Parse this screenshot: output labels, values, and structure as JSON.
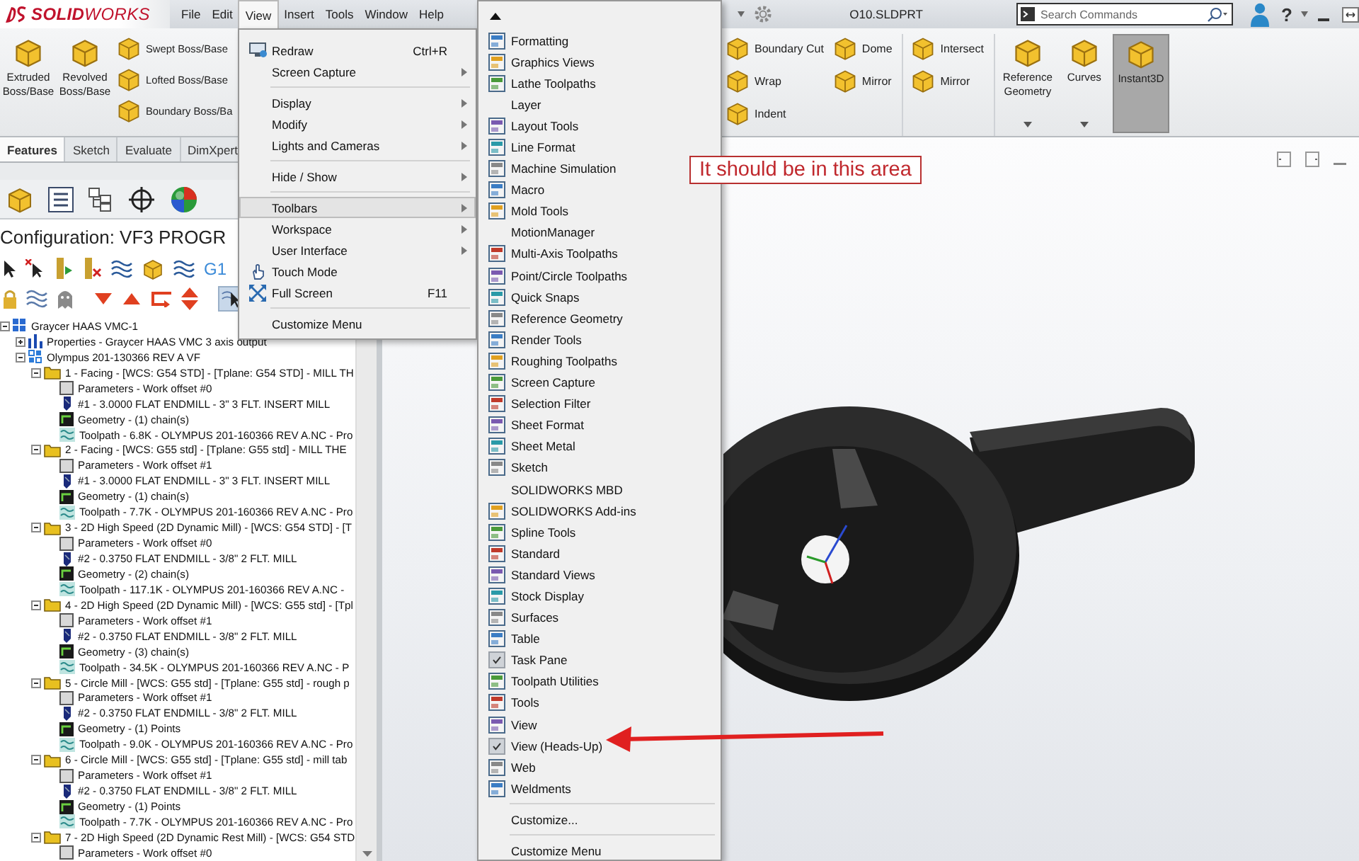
{
  "title_bar": {
    "logo": "**SOLID**WORKS",
    "menus": [
      {
        "label": "File",
        "selected": false
      },
      {
        "label": "Edit",
        "selected": false
      },
      {
        "label": "View",
        "selected": true
      },
      {
        "label": "Insert",
        "selected": false
      },
      {
        "label": "Tools",
        "selected": false
      },
      {
        "label": "Window",
        "selected": false
      },
      {
        "label": "Help",
        "selected": false
      }
    ],
    "document_title": "O10.SLDPRT",
    "search": {
      "placeholder": "Search Commands"
    },
    "help": "?"
  },
  "ribbon": {
    "left": [
      {
        "kind": "large",
        "label": "Extruded Boss/Base",
        "selected": false,
        "dropdown": false
      },
      {
        "kind": "large",
        "label": "Revolved Boss/Base",
        "selected": false,
        "dropdown": false
      },
      {
        "kind": "stack",
        "items": [
          "Swept Boss/Base",
          "Lofted Boss/Base",
          "Boundary Boss/Ba"
        ]
      }
    ],
    "right": [
      {
        "kind": "stack",
        "items": [
          "Boundary Cut",
          "Wrap",
          "Indent"
        ]
      },
      {
        "kind": "stack",
        "items": [
          "Dome",
          "Mirror"
        ]
      },
      {
        "kind": "stack",
        "items": [
          "Intersect",
          "Mirror"
        ]
      },
      {
        "kind": "large",
        "label": "Reference Geometry",
        "selected": false,
        "dropdown": true
      },
      {
        "kind": "large",
        "label": "Curves",
        "selected": false,
        "dropdown": true
      },
      {
        "kind": "large",
        "label": "Instant3D",
        "selected": true,
        "dropdown": false
      }
    ]
  },
  "feature_manager": {
    "tabs": [
      {
        "label": "Features",
        "selected": true
      },
      {
        "label": "Sketch",
        "selected": false
      },
      {
        "label": "Evaluate",
        "selected": false
      },
      {
        "label": "DimXpert",
        "selected": false
      }
    ],
    "configuration": "Configuration:  VF3 PROGR",
    "toolbar_label": "G1",
    "tree": [
      {
        "kind": "machine",
        "label": "Graycer HAAS VMC-1",
        "expanded": true,
        "children": [
          {
            "kind": "properties",
            "label": "Properties - Graycer HAAS VMC 3 axis output",
            "expanded": false
          },
          {
            "kind": "group",
            "label": "Olympus 201-130366 REV A VF",
            "expanded": true,
            "children": [
              {
                "kind": "operation",
                "label": "1 - Facing - [WCS: G54 STD] - [Tplane: G54 STD] - MILL TH",
                "expanded": true,
                "children": [
                  {
                    "kind": "parameters",
                    "label": "Parameters - Work offset #0"
                  },
                  {
                    "kind": "tool",
                    "label": "#1 - 3.0000 FLAT ENDMILL - 3\" 3 FLT. INSERT MILL"
                  },
                  {
                    "kind": "geometry",
                    "label": "Geometry - (1) chain(s)"
                  },
                  {
                    "kind": "toolpath",
                    "label": "Toolpath - 6.8K - OLYMPUS 201-160366 REV A.NC - Pro"
                  }
                ]
              },
              {
                "kind": "operation",
                "label": "2 - Facing - [WCS: G55 std] - [Tplane: G55 std] - MILL THE",
                "expanded": true,
                "children": [
                  {
                    "kind": "parameters",
                    "label": "Parameters - Work offset #1"
                  },
                  {
                    "kind": "tool",
                    "label": "#1 - 3.0000 FLAT ENDMILL - 3\" 3 FLT. INSERT MILL"
                  },
                  {
                    "kind": "geometry",
                    "label": "Geometry - (1) chain(s)"
                  },
                  {
                    "kind": "toolpath",
                    "label": "Toolpath - 7.7K - OLYMPUS 201-160366 REV A.NC - Pro"
                  }
                ]
              },
              {
                "kind": "operation",
                "label": "3 - 2D High Speed (2D Dynamic Mill) - [WCS: G54 STD] - [T",
                "expanded": true,
                "children": [
                  {
                    "kind": "parameters",
                    "label": "Parameters - Work offset #0"
                  },
                  {
                    "kind": "tool",
                    "label": "#2 - 0.3750 FLAT ENDMILL - 3/8\" 2 FLT. MILL"
                  },
                  {
                    "kind": "geometry",
                    "label": "Geometry - (2) chain(s)"
                  },
                  {
                    "kind": "toolpath",
                    "label": "Toolpath - 117.1K - OLYMPUS 201-160366 REV A.NC -"
                  }
                ]
              },
              {
                "kind": "operation",
                "label": "4 - 2D High Speed (2D Dynamic Mill) - [WCS: G55 std] - [Tpl",
                "expanded": true,
                "children": [
                  {
                    "kind": "parameters",
                    "label": "Parameters - Work offset #1"
                  },
                  {
                    "kind": "tool",
                    "label": "#2 - 0.3750 FLAT ENDMILL - 3/8\" 2 FLT. MILL"
                  },
                  {
                    "kind": "geometry",
                    "label": "Geometry - (3) chain(s)"
                  },
                  {
                    "kind": "toolpath",
                    "label": "Toolpath - 34.5K - OLYMPUS 201-160366 REV A.NC - P"
                  }
                ]
              },
              {
                "kind": "operation",
                "label": "5 - Circle Mill - [WCS: G55 std] - [Tplane: G55 std] - rough p",
                "expanded": true,
                "children": [
                  {
                    "kind": "parameters",
                    "label": "Parameters - Work offset #1"
                  },
                  {
                    "kind": "tool",
                    "label": "#2 - 0.3750 FLAT ENDMILL - 3/8\" 2 FLT. MILL"
                  },
                  {
                    "kind": "geometry",
                    "label": "Geometry - (1) Points"
                  },
                  {
                    "kind": "toolpath",
                    "label": "Toolpath - 9.0K - OLYMPUS 201-160366 REV A.NC - Pro"
                  }
                ]
              },
              {
                "kind": "operation",
                "label": "6 - Circle Mill - [WCS: G55 std] - [Tplane: G55 std] - mill tab",
                "expanded": true,
                "children": [
                  {
                    "kind": "parameters",
                    "label": "Parameters - Work offset #1"
                  },
                  {
                    "kind": "tool",
                    "label": "#2 - 0.3750 FLAT ENDMILL - 3/8\" 2 FLT. MILL"
                  },
                  {
                    "kind": "geometry",
                    "label": "Geometry - (1) Points"
                  },
                  {
                    "kind": "toolpath",
                    "label": "Toolpath - 7.7K - OLYMPUS 201-160366 REV A.NC - Pro"
                  }
                ]
              },
              {
                "kind": "operation",
                "label": "7 - 2D High Speed (2D Dynamic Rest Mill) - [WCS: G54 STD",
                "expanded": true,
                "children": [
                  {
                    "kind": "parameters",
                    "label": "Parameters - Work offset #0"
                  }
                ]
              }
            ]
          }
        ]
      }
    ]
  },
  "graphics": {
    "annotation": "It should be in this area"
  },
  "view_menu": {
    "sections": [
      [
        {
          "label": "Redraw",
          "icon": true,
          "shortcut": "Ctrl+R",
          "submenu": false,
          "selected": false
        },
        {
          "label": "Screen Capture",
          "icon": false,
          "submenu": true,
          "selected": false
        }
      ],
      [
        {
          "label": "Display",
          "icon": false,
          "submenu": true,
          "selected": false
        },
        {
          "label": "Modify",
          "icon": false,
          "submenu": true,
          "selected": false
        },
        {
          "label": "Lights and Cameras",
          "icon": false,
          "submenu": true,
          "selected": false
        }
      ],
      [
        {
          "label": "Hide / Show",
          "icon": false,
          "submenu": true,
          "selected": false
        }
      ],
      [
        {
          "label": "Toolbars",
          "icon": false,
          "submenu": true,
          "selected": true
        },
        {
          "label": "Workspace",
          "icon": false,
          "submenu": true,
          "selected": false
        },
        {
          "label": "User Interface",
          "icon": false,
          "submenu": true,
          "selected": false
        },
        {
          "label": "Touch Mode",
          "icon": true,
          "submenu": false,
          "selected": false
        },
        {
          "label": "Full Screen",
          "icon": true,
          "shortcut": "F11",
          "submenu": false,
          "selected": false
        }
      ],
      [
        {
          "label": "Customize Menu",
          "icon": false,
          "submenu": false,
          "selected": false
        }
      ]
    ]
  },
  "toolbars_menu": {
    "items": [
      {
        "label": "Formatting",
        "kind": "icon",
        "checked": false
      },
      {
        "label": "Graphics Views",
        "kind": "icon",
        "checked": false
      },
      {
        "label": "Lathe Toolpaths",
        "kind": "icon",
        "checked": false
      },
      {
        "label": "Layer",
        "kind": "plain",
        "checked": false
      },
      {
        "label": "Layout Tools",
        "kind": "icon",
        "checked": false
      },
      {
        "label": "Line Format",
        "kind": "icon",
        "checked": false
      },
      {
        "label": "Machine Simulation",
        "kind": "icon",
        "checked": false
      },
      {
        "label": "Macro",
        "kind": "icon",
        "checked": false
      },
      {
        "label": "Mold Tools",
        "kind": "icon",
        "checked": false
      },
      {
        "label": "MotionManager",
        "kind": "plain",
        "checked": false
      },
      {
        "label": "Multi-Axis Toolpaths",
        "kind": "icon",
        "checked": false
      },
      {
        "label": "Point/Circle Toolpaths",
        "kind": "icon",
        "checked": false
      },
      {
        "label": "Quick Snaps",
        "kind": "icon",
        "checked": false
      },
      {
        "label": "Reference Geometry",
        "kind": "icon",
        "checked": false
      },
      {
        "label": "Render Tools",
        "kind": "icon",
        "checked": false
      },
      {
        "label": "Roughing Toolpaths",
        "kind": "icon",
        "checked": false
      },
      {
        "label": "Screen Capture",
        "kind": "icon",
        "checked": false
      },
      {
        "label": "Selection Filter",
        "kind": "icon",
        "checked": false
      },
      {
        "label": "Sheet Format",
        "kind": "icon",
        "checked": false
      },
      {
        "label": "Sheet Metal",
        "kind": "icon",
        "checked": false
      },
      {
        "label": "Sketch",
        "kind": "icon",
        "checked": false
      },
      {
        "label": "SOLIDWORKS MBD",
        "kind": "plain",
        "checked": false
      },
      {
        "label": "SOLIDWORKS Add-ins",
        "kind": "icon",
        "checked": false
      },
      {
        "label": "Spline Tools",
        "kind": "icon",
        "checked": false
      },
      {
        "label": "Standard",
        "kind": "icon",
        "checked": false
      },
      {
        "label": "Standard Views",
        "kind": "icon",
        "checked": false
      },
      {
        "label": "Stock Display",
        "kind": "icon",
        "checked": false
      },
      {
        "label": "Surfaces",
        "kind": "icon",
        "checked": false
      },
      {
        "label": "Table",
        "kind": "icon",
        "checked": false
      },
      {
        "label": "Task Pane",
        "kind": "icon",
        "checked": true
      },
      {
        "label": "Toolpath Utilities",
        "kind": "icon",
        "checked": false
      },
      {
        "label": "Tools",
        "kind": "icon",
        "checked": false
      },
      {
        "label": "View",
        "kind": "icon",
        "checked": false
      },
      {
        "label": "View (Heads-Up)",
        "kind": "icon",
        "checked": true
      },
      {
        "label": "Web",
        "kind": "icon",
        "checked": false
      },
      {
        "label": "Weldments",
        "kind": "icon",
        "checked": false
      }
    ],
    "footer_items": [
      "Customize...",
      "Customize Menu"
    ]
  }
}
